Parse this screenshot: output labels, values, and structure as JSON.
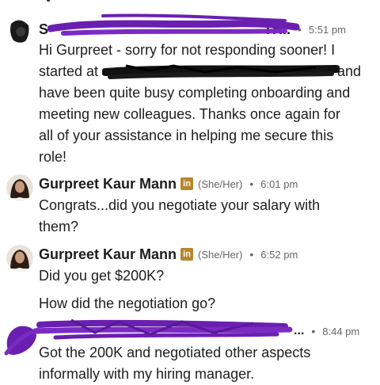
{
  "thread": {
    "messages": [
      {
        "sender_visible": "S",
        "name_tail": "TH..",
        "pronouns": "",
        "time": "5:51 pm",
        "lines": [
          "Hi Gurpreet - sorry for not responding sooner!  I",
          "started at",
          "and",
          "have been quite busy completing onboarding and",
          "meeting new colleagues.  Thanks once again for",
          "all of your assistance in helping me secure this",
          "role!"
        ]
      },
      {
        "name": "Gurpreet Kaur Mann",
        "badge": "in",
        "pronouns": "(She/Her)",
        "time": "6:01 pm",
        "lines": [
          "Congrats...did you negotiate your salary with",
          "them?"
        ]
      },
      {
        "name": "Gurpreet Kaur Mann",
        "badge": "in",
        "pronouns": "(She/Her)",
        "time": "6:52 pm",
        "lines": [
          "Did you get $200K?",
          "How did the negotiation go?"
        ]
      },
      {
        "name_tail": "...",
        "time": "8:44 pm",
        "lines": [
          "Got the 200K and negotiated other aspects",
          "informally with my hiring manager."
        ]
      }
    ],
    "separator": "•"
  },
  "colors": {
    "redaction": "#6a1fb0",
    "badge": "#b8862d",
    "meta_text": "#666666"
  }
}
